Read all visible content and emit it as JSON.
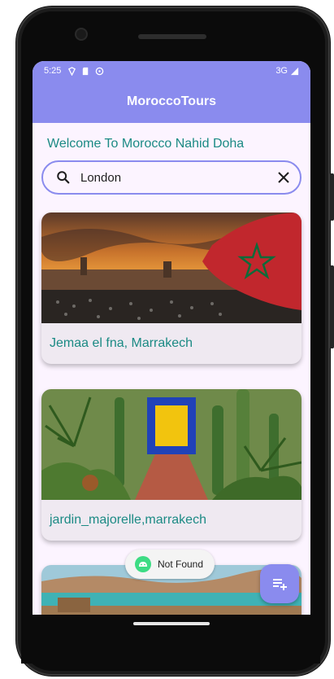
{
  "status_bar": {
    "time": "5:25",
    "network": "3G"
  },
  "app_bar": {
    "title": "MoroccoTours"
  },
  "welcome_text": "Welcome To Morocco Nahid Doha",
  "search": {
    "value": "London",
    "search_icon": "search-icon",
    "clear_icon": "close-icon"
  },
  "cards": [
    {
      "caption": "Jemaa el fna, Marrakech"
    },
    {
      "caption": "jardin_majorelle,marrakech"
    },
    {
      "caption": ""
    }
  ],
  "toast": {
    "text": "Not Found",
    "icon": "android-icon"
  },
  "fab": {
    "icon": "playlist-add-icon"
  },
  "colors": {
    "primary": "#8a8bee",
    "teal_text": "#1b8a84",
    "background": "#fcf4ff"
  }
}
